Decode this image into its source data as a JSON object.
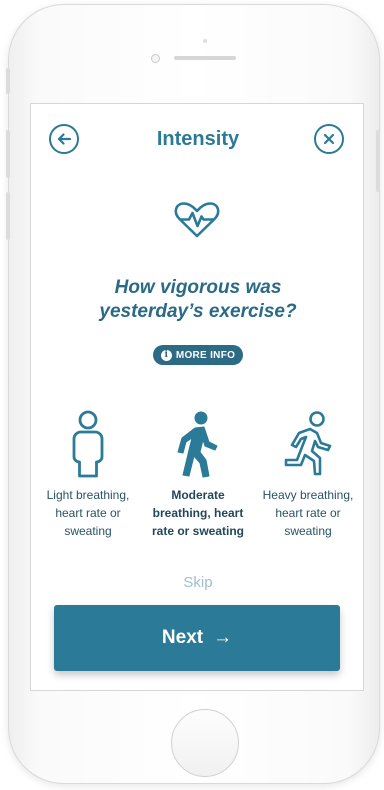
{
  "header": {
    "title": "Intensity",
    "back_icon": "arrow-left-circle-icon",
    "close_icon": "close-circle-icon"
  },
  "hero_icon": "heartbeat-icon",
  "question": {
    "line1": "How vigorous was",
    "line2": "yesterday’s exercise?"
  },
  "more_info": {
    "label": "MORE INFO",
    "icon": "info-icon"
  },
  "options": [
    {
      "line1": "Light breathing,",
      "line2": "heart rate or",
      "line3": "sweating",
      "icon": "standing-person-icon",
      "selected": false
    },
    {
      "line1": "Moderate",
      "line2": "breathing, heart",
      "line3": "rate or sweating",
      "icon": "walking-person-icon",
      "selected": true
    },
    {
      "line1": "Heavy breathing,",
      "line2": "heart rate or",
      "line3": "sweating",
      "icon": "running-person-icon",
      "selected": false
    }
  ],
  "skip_label": "Skip",
  "next": {
    "label": "Next",
    "arrow": "→"
  },
  "colors": {
    "accent": "#2b7a97",
    "dark_accent": "#2d6b85",
    "skip": "#9fbfcd"
  }
}
